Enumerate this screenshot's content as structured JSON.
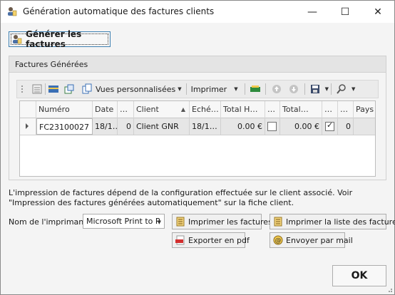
{
  "window": {
    "title": "Génération automatique des factures clients",
    "controls": {
      "minimize": "—",
      "maximize": "☐",
      "close": "✕"
    }
  },
  "actions": {
    "generate_label": "Générer les factures"
  },
  "group": {
    "title": "Factures Générées"
  },
  "toolbar": {
    "custom_views_label": "Vues personnalisées",
    "print_label": "Imprimer"
  },
  "grid": {
    "columns": [
      "Numéro",
      "Date",
      "…",
      "Client",
      "Eché…",
      "Total H…",
      "…",
      "Total…",
      "…",
      "…",
      "Pays"
    ],
    "rows": [
      {
        "numero": "FC23100027",
        "date": "18/1…",
        "col3": "0",
        "client": "Client GNR",
        "echeance": "18/1…",
        "total_ht": "0.00 €",
        "check1": false,
        "total_ttc": "0.00 €",
        "check2": true,
        "col10": "0",
        "pays": ""
      }
    ]
  },
  "info": {
    "text": "L'impression de factures dépend de la configuration effectuée sur le client associé. Voir \"Impression des factures générées automatiquement\" sur la fiche client."
  },
  "printer": {
    "label": "Nom de l'imprimante:",
    "selected": "Microsoft Print to P"
  },
  "buttons": {
    "print_invoices": "Imprimer les factures",
    "print_list": "Imprimer la liste des factures",
    "export_pdf": "Exporter en pdf",
    "send_mail": "Envoyer par mail",
    "ok": "OK"
  },
  "colors": {
    "accent": "#3c7fb1",
    "row_selected": "#e6e6e6",
    "pdf_red": "#d32f2f"
  }
}
